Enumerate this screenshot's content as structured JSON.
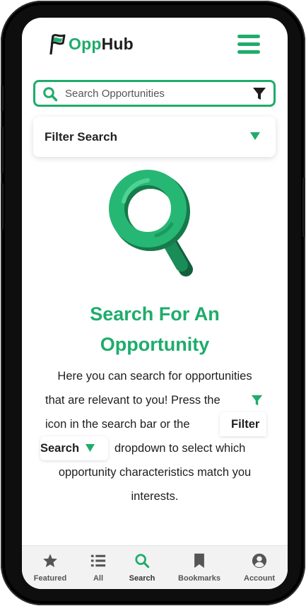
{
  "app": {
    "name_prefix": "Opp",
    "name_suffix": "Hub"
  },
  "search": {
    "placeholder": "Search Opportunities",
    "value": ""
  },
  "filter": {
    "label": "Filter Search"
  },
  "main": {
    "title_line1": "Search For An",
    "title_line2": "Opportunity",
    "para": {
      "line1": "Here you can search for opportunities",
      "line2": "that are relevant to you! Press the",
      "line3": "icon in the search bar or the",
      "pill_part1": "Filter",
      "pill_part2": "Search",
      "line4": "dropdown to select which",
      "line5": "opportunity characteristics match you",
      "line6": "interests."
    }
  },
  "nav": {
    "items": [
      {
        "label": "Featured",
        "icon": "star-icon"
      },
      {
        "label": "All",
        "icon": "list-icon"
      },
      {
        "label": "Search",
        "icon": "search-icon"
      },
      {
        "label": "Bookmarks",
        "icon": "bookmark-icon"
      },
      {
        "label": "Account",
        "icon": "account-icon"
      }
    ],
    "active": "Search"
  },
  "colors": {
    "accent": "#1eac6b",
    "dark": "#1d1d1d",
    "nav_bg": "#f2f2f2"
  }
}
